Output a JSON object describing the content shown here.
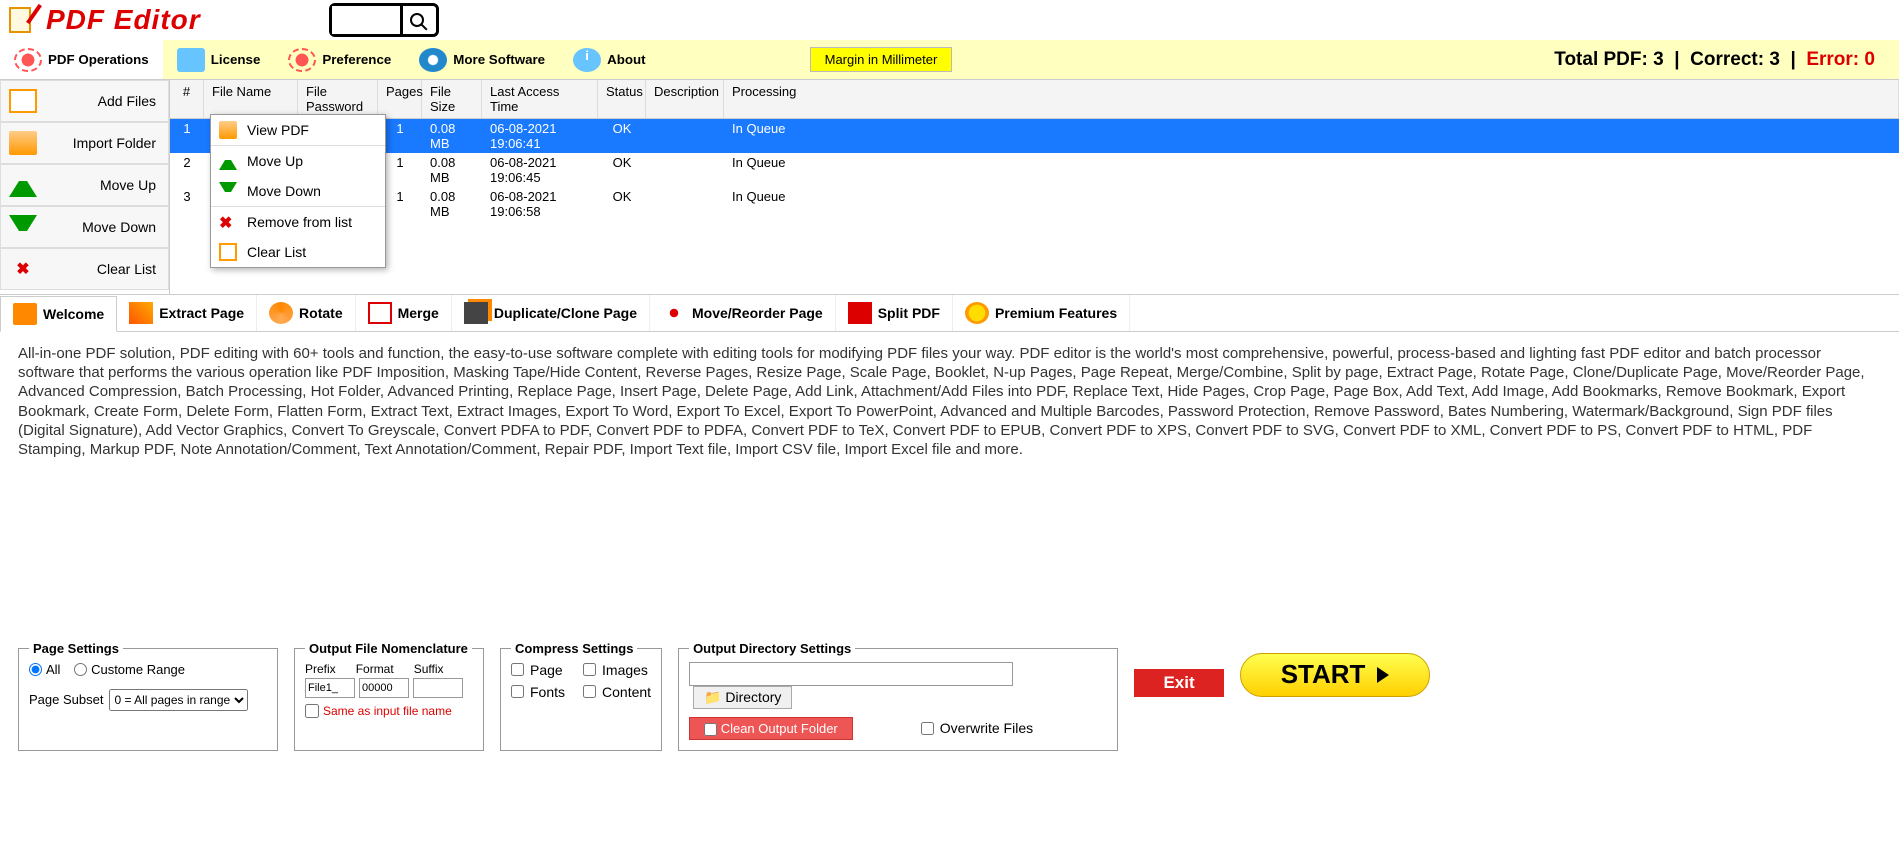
{
  "app": {
    "title": "PDF Editor"
  },
  "toolbar": {
    "ops": "PDF Operations",
    "license": "License",
    "preference": "Preference",
    "more": "More Software",
    "about": "About",
    "margin_badge": "Margin in Millimeter"
  },
  "stats": {
    "total_label": "Total PDF:",
    "total": 3,
    "correct_label": "Correct:",
    "correct": 3,
    "error_label": "Error:",
    "error": 0
  },
  "sidebar": {
    "add_files": "Add Files",
    "import_folder": "Import Folder",
    "move_up": "Move Up",
    "move_down": "Move Down",
    "clear_list": "Clear List"
  },
  "grid": {
    "headers": {
      "num": "#",
      "name": "File Name",
      "pass": "File Password",
      "pages": "Pages",
      "size": "File Size",
      "time": "Last Access Time",
      "status": "Status",
      "desc": "Description",
      "proc": "Processing"
    },
    "rows": [
      {
        "num": 1,
        "pages": 1,
        "size": "0.08 MB",
        "time": "06-08-2021 19:06:41",
        "status": "OK",
        "proc": "In Queue"
      },
      {
        "num": 2,
        "pages": 1,
        "size": "0.08 MB",
        "time": "06-08-2021 19:06:45",
        "status": "OK",
        "proc": "In Queue"
      },
      {
        "num": 3,
        "pages": 1,
        "size": "0.08 MB",
        "time": "06-08-2021 19:06:58",
        "status": "OK",
        "proc": "In Queue"
      }
    ]
  },
  "ctx": {
    "view": "View PDF",
    "up": "Move Up",
    "down": "Move Down",
    "remove": "Remove from list",
    "clear": "Clear List"
  },
  "tabs": {
    "welcome": "Welcome",
    "extract": "Extract Page",
    "rotate": "Rotate",
    "merge": "Merge",
    "dup": "Duplicate/Clone Page",
    "move": "Move/Reorder Page",
    "split": "Split PDF",
    "premium": "Premium Features"
  },
  "description": "All-in-one PDF solution, PDF editing with 60+ tools and function, the easy-to-use software complete with editing tools for modifying PDF files your way. PDF editor is the world's most comprehensive, powerful, process-based and lighting fast PDF editor and batch processor software that performs the various operation like PDF Imposition, Masking Tape/Hide Content, Reverse Pages, Resize Page, Scale Page, Booklet, N-up Pages, Page Repeat, Merge/Combine, Split by page, Extract Page, Rotate Page, Clone/Duplicate Page, Move/Reorder Page, Advanced Compression, Batch Processing, Hot Folder, Advanced Printing, Replace Page, Insert Page, Delete Page, Add Link, Attachment/Add Files into PDF, Replace Text, Hide Pages, Crop Page, Page Box, Add Text, Add Image, Add Bookmarks, Remove Bookmark, Export Bookmark, Create Form, Delete Form, Flatten Form, Extract Text, Extract Images, Export To Word, Export To Excel, Export To PowerPoint, Advanced and Multiple Barcodes, Password Protection, Remove Password, Bates Numbering,  Watermark/Background, Sign PDF files (Digital Signature), Add Vector Graphics, Convert To Greyscale, Convert PDFA to PDF, Convert PDF to PDFA, Convert PDF to TeX, Convert PDF to EPUB, Convert PDF to XPS, Convert PDF to SVG, Convert PDF to XML, Convert PDF to PS, Convert PDF to HTML, PDF Stamping, Markup PDF, Note Annotation/Comment, Text Annotation/Comment, Repair PDF, Import Text file, Import CSV file, Import Excel file and more.",
  "page_settings": {
    "legend": "Page Settings",
    "all": "All",
    "custom": "Custome Range",
    "subset_lbl": "Page Subset",
    "subset_opt": "0 = All pages in range"
  },
  "nomenclature": {
    "legend": "Output File Nomenclature",
    "prefix_lbl": "Prefix",
    "format_lbl": "Format",
    "suffix_lbl": "Suffix",
    "prefix": "File1_",
    "format": "00000",
    "suffix": "",
    "same": "Same as input file name"
  },
  "compress": {
    "legend": "Compress Settings",
    "page": "Page",
    "images": "Images",
    "fonts": "Fonts",
    "content": "Content"
  },
  "output": {
    "legend": "Output Directory Settings",
    "directory": "Directory",
    "clean": "Clean Output Folder",
    "overwrite": "Overwrite Files"
  },
  "actions": {
    "exit": "Exit",
    "start": "START"
  }
}
